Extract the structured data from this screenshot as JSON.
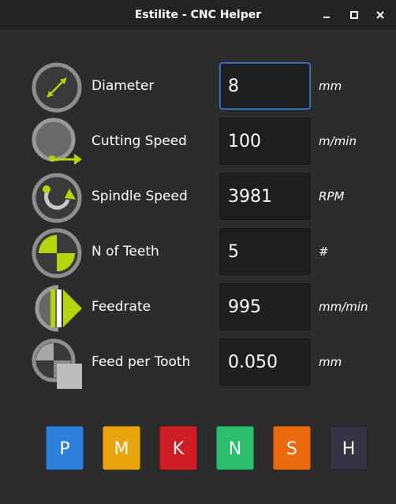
{
  "window": {
    "title": "Estilite - CNC Helper",
    "controls": [
      "minimize-icon",
      "maximize-icon",
      "close-icon"
    ]
  },
  "rows": [
    {
      "label": "Diameter",
      "value": "8",
      "unit": "mm",
      "icon": "diameter-icon"
    },
    {
      "label": "Cutting Speed",
      "value": "100",
      "unit": "m/min",
      "icon": "cutting-speed-icon"
    },
    {
      "label": "Spindle Speed",
      "value": "3981",
      "unit": "RPM",
      "icon": "spindle-speed-icon"
    },
    {
      "label": "N of Teeth",
      "value": "5",
      "unit": "#",
      "icon": "teeth-icon"
    },
    {
      "label": "Feedrate",
      "value": "995",
      "unit": "mm/min",
      "icon": "feedrate-icon"
    },
    {
      "label": "Feed per Tooth",
      "value": "0.050",
      "unit": "mm",
      "icon": "feed-per-tooth-icon"
    }
  ],
  "materials": [
    {
      "label": "P",
      "color": "#2f7fdc"
    },
    {
      "label": "M",
      "color": "#e8a40c"
    },
    {
      "label": "K",
      "color": "#cf1f25"
    },
    {
      "label": "N",
      "color": "#2dbf6c"
    },
    {
      "label": "S",
      "color": "#ec6a0f"
    },
    {
      "label": "H",
      "color": "#383344"
    }
  ],
  "colors": {
    "accent": "#b6d40a",
    "icon_ring": "#8e8e8e",
    "focus": "#3d7bd6"
  }
}
